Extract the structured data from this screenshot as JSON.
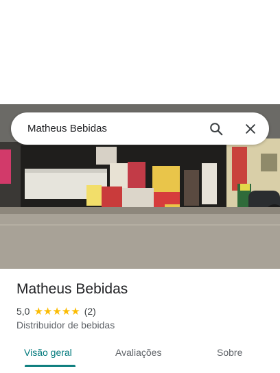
{
  "search": {
    "query": "Matheus Bebidas"
  },
  "place": {
    "name": "Matheus Bebidas",
    "rating": "5,0",
    "stars": "★★★★★",
    "review_count": "(2)",
    "category": "Distribuidor de bebidas"
  },
  "tabs": [
    {
      "label": "Visão geral",
      "active": true
    },
    {
      "label": "Avaliações",
      "active": false
    },
    {
      "label": "Sobre",
      "active": false
    }
  ],
  "colors": {
    "accent": "#0f7f7f",
    "star": "#fbbc04"
  }
}
